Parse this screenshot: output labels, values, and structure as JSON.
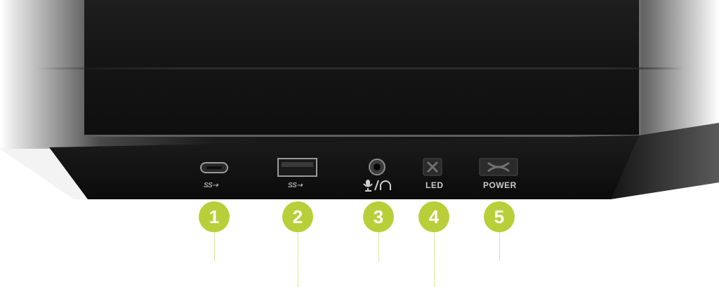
{
  "labels": {
    "led": "LED",
    "power": "POWER",
    "superspeed_1": "SS",
    "superspeed_2": "SS"
  },
  "callouts": [
    "1",
    "2",
    "3",
    "4",
    "5"
  ],
  "icons": {
    "usb_c_port": "usb-c-port-icon",
    "usb_a_port": "usb-a-port-icon",
    "audio_jack": "audio-jack-icon",
    "mic_headphone": "mic-headphone-icon",
    "led_button": "led-button-icon",
    "power_button": "power-button-icon"
  },
  "colors": {
    "callout_green": "#b8cf3a",
    "panel_black": "#111111",
    "label_gray": "#c9c9c9"
  }
}
